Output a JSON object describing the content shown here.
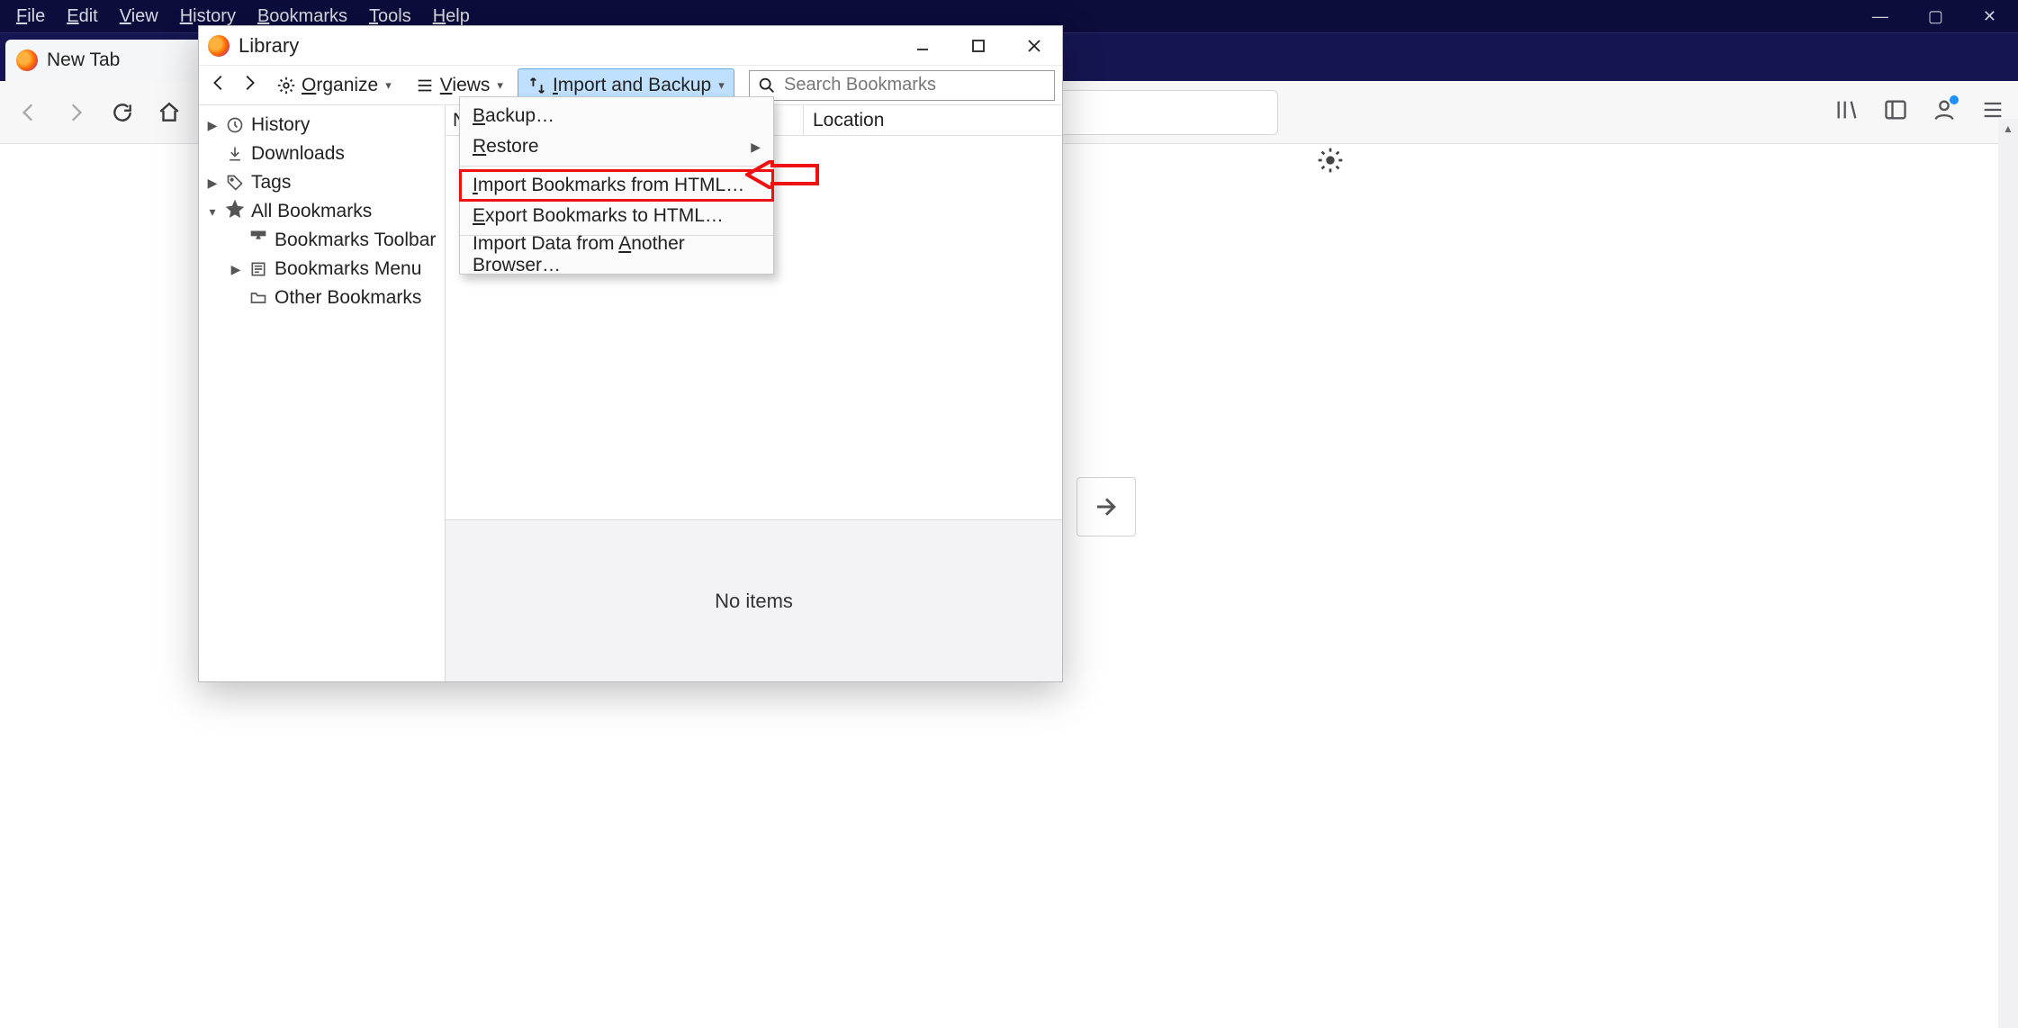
{
  "main_menu": {
    "file": "File",
    "edit": "Edit",
    "view": "View",
    "history": "History",
    "bookmarks": "Bookmarks",
    "tools": "Tools",
    "help": "Help"
  },
  "tab": {
    "title": "New Tab"
  },
  "library": {
    "title": "Library",
    "toolbar": {
      "organize": "Organize",
      "views": "Views",
      "import_backup": "Import and Backup"
    },
    "search_placeholder": "Search Bookmarks",
    "tree": {
      "history": "History",
      "downloads": "Downloads",
      "tags": "Tags",
      "all_bookmarks": "All Bookmarks",
      "bookmarks_toolbar": "Bookmarks Toolbar",
      "bookmarks_menu": "Bookmarks Menu",
      "other_bookmarks": "Other Bookmarks"
    },
    "columns": {
      "name": "N",
      "location": "Location"
    },
    "detail_empty": "No items"
  },
  "dropdown": {
    "backup": "Backup…",
    "restore": "Restore",
    "import_html": "Import Bookmarks from HTML…",
    "export_html": "Export Bookmarks to HTML…",
    "import_other": "Import Data from Another Browser…"
  }
}
